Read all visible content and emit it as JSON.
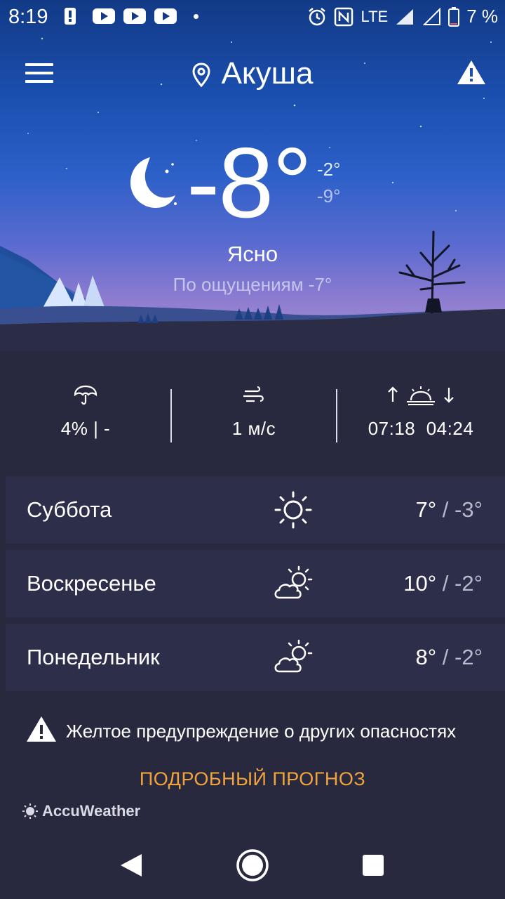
{
  "status_bar": {
    "time": "8:19",
    "network": "LTE",
    "battery": "7 %"
  },
  "location": {
    "city": "Акуша"
  },
  "current": {
    "temp": "-8°",
    "high": "-2°",
    "low": "-9°",
    "condition": "Ясно",
    "feels_like": "По ощущениям -7°"
  },
  "stats": {
    "precip": "4% | -",
    "wind": "1 м/с",
    "sunrise": "07:18",
    "sunset": "04:24"
  },
  "forecast": [
    {
      "day": "Суббота",
      "high": "7°",
      "low": "-3°",
      "icon": "sun-icon"
    },
    {
      "day": "Воскресенье",
      "high": "10°",
      "low": "-2°",
      "icon": "partly-cloudy-icon"
    },
    {
      "day": "Понедельник",
      "high": "8°",
      "low": "-2°",
      "icon": "partly-cloudy-icon"
    }
  ],
  "forecast_sep": "/",
  "alert": {
    "text": "Желтое предупреждение о других опасностях"
  },
  "detail_link": "ПОДРОБНЫЙ ПРОГНОЗ",
  "brand": "AccuWeather",
  "colors": {
    "accent": "#f1a33c",
    "background": "#28293f",
    "row": "#2d2f4a"
  }
}
